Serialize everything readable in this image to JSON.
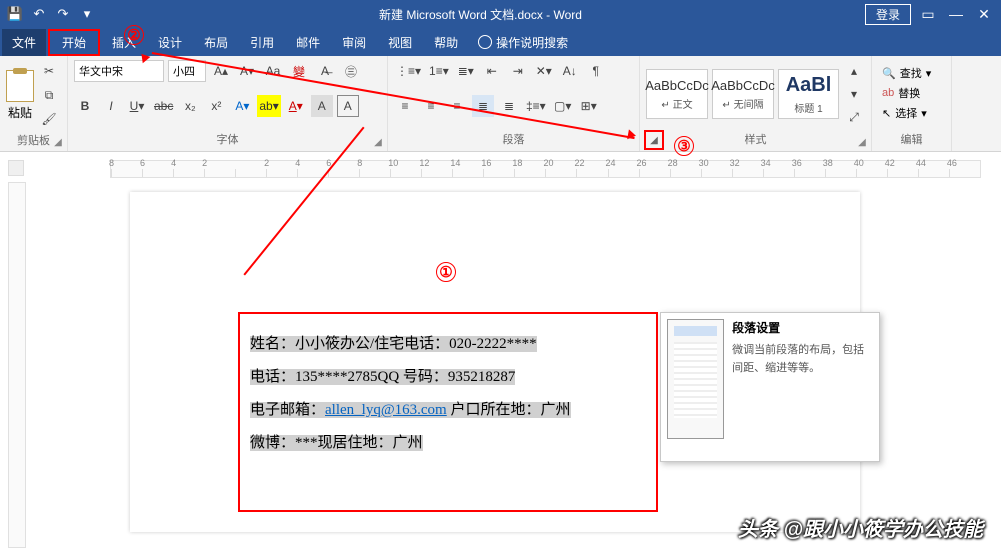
{
  "titlebar": {
    "title": "新建 Microsoft Word 文档.docx  -  Word",
    "login": "登录"
  },
  "menubar": {
    "file": "文件",
    "home": "开始",
    "insert": "插入",
    "design": "设计",
    "layout": "布局",
    "references": "引用",
    "mailings": "邮件",
    "review": "审阅",
    "view": "视图",
    "help": "帮助",
    "tell_me": "操作说明搜索"
  },
  "ribbon": {
    "clipboard": {
      "paste": "粘贴",
      "label": "剪贴板"
    },
    "font": {
      "name": "华文中宋",
      "size": "小四",
      "label": "字体"
    },
    "paragraph": {
      "label": "段落"
    },
    "styles": {
      "label": "样式",
      "items": [
        {
          "preview": "AaBbCcDc",
          "caption": "↵ 正文"
        },
        {
          "preview": "AaBbCcDc",
          "caption": "↵ 无间隔"
        },
        {
          "preview": "AaBl",
          "caption": "标题 1"
        }
      ]
    },
    "editing": {
      "find": "查找",
      "replace": "替换",
      "select": "选择",
      "label": "编辑"
    }
  },
  "ruler_ticks": [
    "8",
    "6",
    "4",
    "2",
    "",
    "2",
    "4",
    "6",
    "8",
    "10",
    "12",
    "14",
    "16",
    "18",
    "20",
    "22",
    "24",
    "26",
    "28",
    "30",
    "32",
    "34",
    "36",
    "38",
    "40",
    "42",
    "44",
    "46"
  ],
  "tooltip": {
    "title": "段落设置",
    "body": "微调当前段落的布局，包括间距、缩进等等。"
  },
  "document": {
    "l1a": "姓名：小小筱办公/住宅电话：020-2222****",
    "l2a": "电话：135****2785QQ 号码：935218287",
    "l3a": "电子邮箱：",
    "l3link": "allen_lyq@163.com",
    "l3b": " 户口所在地：广州",
    "l4a": "微博：***现居住地：广州"
  },
  "annotations": {
    "a1": "①",
    "a2": "②",
    "a3": "③"
  },
  "watermark": "头条 @跟小小筱学办公技能"
}
